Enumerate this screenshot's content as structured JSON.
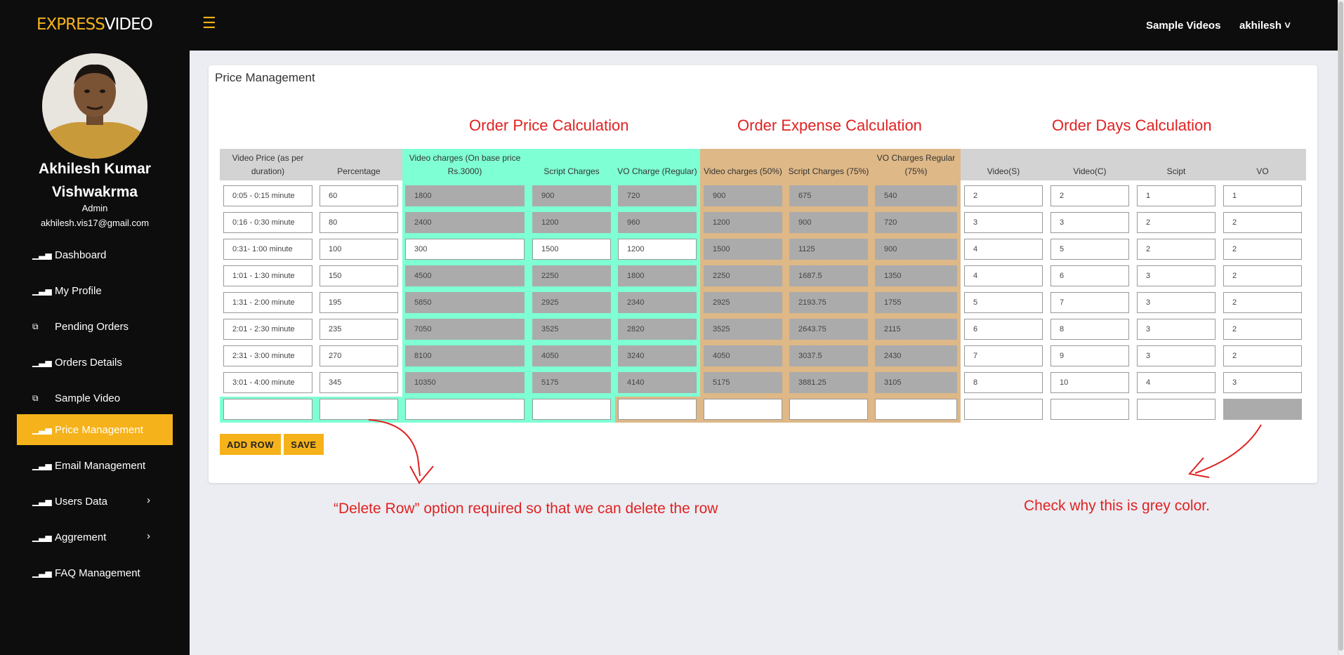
{
  "brand": {
    "logo_part1": "EXPRESS",
    "logo_part2": "VIDEO"
  },
  "topbar": {
    "menu_icon": "hamburger-icon",
    "sample_videos": "Sample Videos",
    "user": "akhilesh ˅"
  },
  "profile": {
    "name_line1": "Akhilesh Kumar",
    "name_line2": "Vishwakrma",
    "role": "Admin",
    "email": "akhilesh.vis17@gmail.com"
  },
  "sidebar": {
    "items": [
      {
        "label": "Dashboard",
        "icon": "bar-chart-icon"
      },
      {
        "label": "My Profile",
        "icon": "bar-chart-icon"
      },
      {
        "label": "Pending Orders",
        "icon": "copy-icon"
      },
      {
        "label": "Orders Details",
        "icon": "bar-chart-icon"
      },
      {
        "label": "Sample Video",
        "icon": "copy-icon"
      },
      {
        "label": "Price Management",
        "icon": "bar-chart-icon",
        "active": true
      },
      {
        "label": "Email Management",
        "icon": "bar-chart-icon"
      },
      {
        "label": "Users Data",
        "icon": "bar-chart-icon",
        "arrow": "›"
      },
      {
        "label": "Aggrement",
        "icon": "bar-chart-icon",
        "arrow": "›"
      },
      {
        "label": "FAQ Management",
        "icon": "bar-chart-icon"
      }
    ]
  },
  "page": {
    "title": "Price Management"
  },
  "sections": {
    "price": "Order Price Calculation",
    "expense": "Order Expense Calculation",
    "days": "Order Days Calculation"
  },
  "colors": {
    "accent": "#f5b21a",
    "price_bg": "#7fffd4",
    "expense_bg": "#deb887",
    "header_bg": "#d3d3d3",
    "readonly_bg": "#ababab",
    "annotation": "#e02222"
  },
  "table": {
    "headers": [
      "Video Price (as per duration)",
      "Percentage",
      "Video charges (On base price Rs.3000)",
      "Script Charges",
      "VO Charge (Regular)",
      "Video charges (50%)",
      "Script Charges (75%)",
      "VO Charges Regular (75%)",
      "Video(S)",
      "Video(C)",
      "Scipt",
      "VO"
    ],
    "rows": [
      [
        "0:05 - 0:15 minute",
        "60",
        "1800",
        "900",
        "720",
        "900",
        "675",
        "540",
        "2",
        "2",
        "1",
        "1"
      ],
      [
        "0:16 - 0:30 minute",
        "80",
        "2400",
        "1200",
        "960",
        "1200",
        "900",
        "720",
        "3",
        "3",
        "2",
        "2"
      ],
      [
        "0:31- 1:00 minute",
        "100",
        "300",
        "1500",
        "1200",
        "1500",
        "1125",
        "900",
        "4",
        "5",
        "2",
        "2"
      ],
      [
        "1:01 - 1:30 minute",
        "150",
        "4500",
        "2250",
        "1800",
        "2250",
        "1687.5",
        "1350",
        "4",
        "6",
        "3",
        "2"
      ],
      [
        "1:31 - 2:00 minute",
        "195",
        "5850",
        "2925",
        "2340",
        "2925",
        "2193.75",
        "1755",
        "5",
        "7",
        "3",
        "2"
      ],
      [
        "2:01 - 2:30 minute",
        "235",
        "7050",
        "3525",
        "2820",
        "3525",
        "2643.75",
        "2115",
        "6",
        "8",
        "3",
        "2"
      ],
      [
        "2:31 - 3:00 minute",
        "270",
        "8100",
        "4050",
        "3240",
        "4050",
        "3037.5",
        "2430",
        "7",
        "9",
        "3",
        "2"
      ],
      [
        "3:01 - 4:00 minute",
        "345",
        "10350",
        "5175",
        "4140",
        "5175",
        "3881.25",
        "3105",
        "8",
        "10",
        "4",
        "3"
      ],
      [
        "",
        "",
        "",
        "",
        "",
        "",
        "",
        "",
        "",
        "",
        "",
        ""
      ]
    ]
  },
  "buttons": {
    "add_row": "ADD ROW",
    "save": "SAVE"
  },
  "annotations": {
    "delete_note": "“Delete Row” option required so that we can delete the row",
    "grey_note": "Check why this is grey color."
  }
}
